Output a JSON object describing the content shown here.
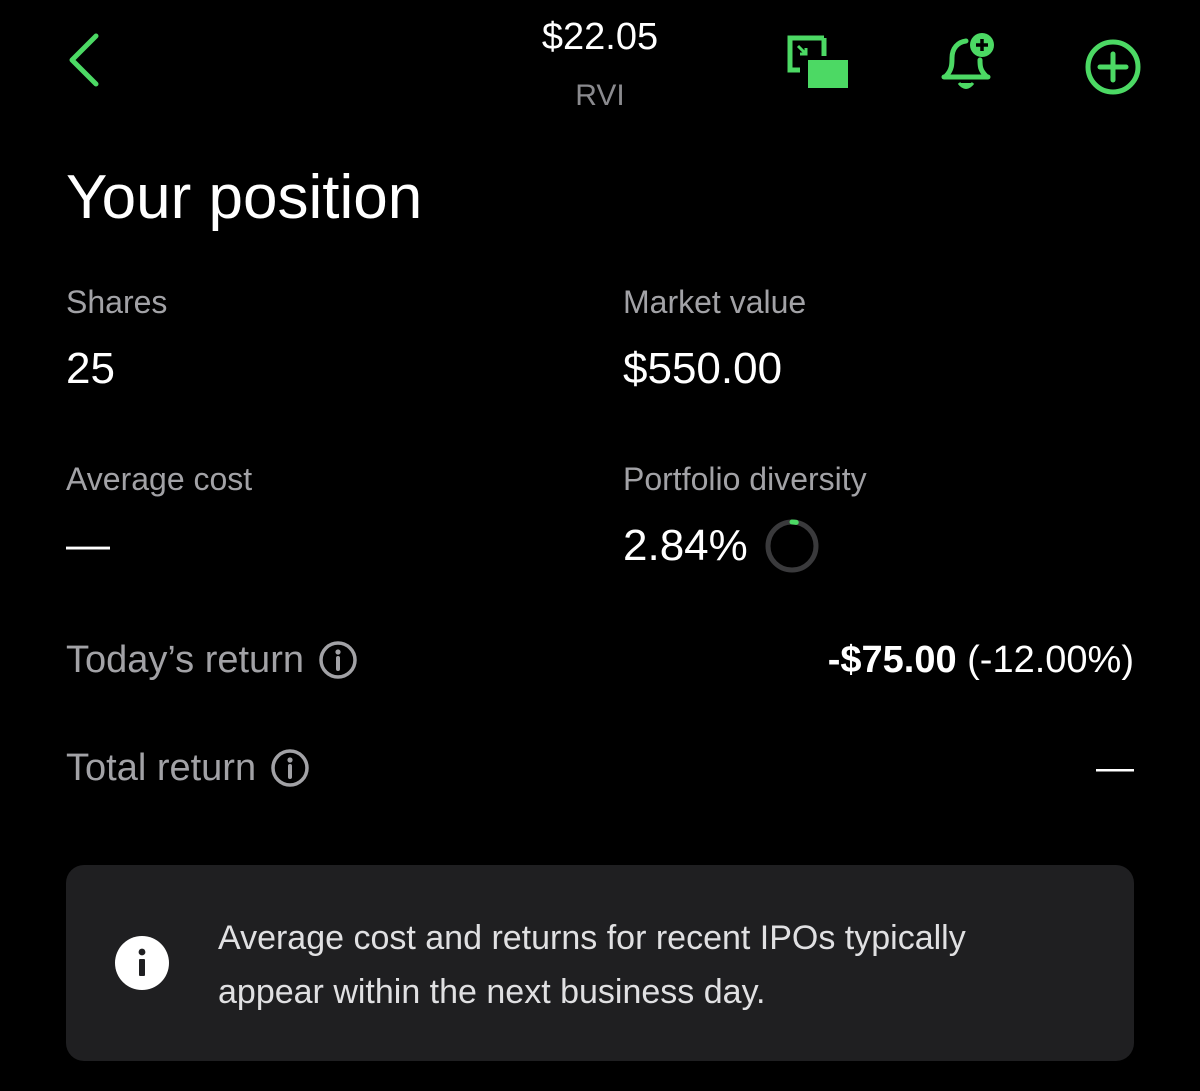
{
  "colors": {
    "accent": "#4cd964",
    "background": "#000000",
    "muted_text": "#a2a2a6",
    "card_background": "#1f1f21"
  },
  "header": {
    "price": "$22.05",
    "ticker": "RVI",
    "icons": [
      "chevron-left-icon",
      "picture-in-picture-icon",
      "bell-plus-icon",
      "plus-circle-icon"
    ]
  },
  "position": {
    "title": "Your position",
    "shares_label": "Shares",
    "shares_value": "25",
    "market_value_label": "Market value",
    "market_value": "$550.00",
    "average_cost_label": "Average cost",
    "average_cost_value": "—",
    "diversity_label": "Portfolio diversity",
    "diversity_value": "2.84%",
    "diversity_fraction": 0.0284
  },
  "returns": {
    "today_label": "Today’s return",
    "today_amount": "-$75.00",
    "today_percent": "(-12.00%)",
    "total_label": "Total return",
    "total_value": "—"
  },
  "notice": {
    "text": "Average cost and returns for recent IPOs typically appear within the next business day."
  }
}
